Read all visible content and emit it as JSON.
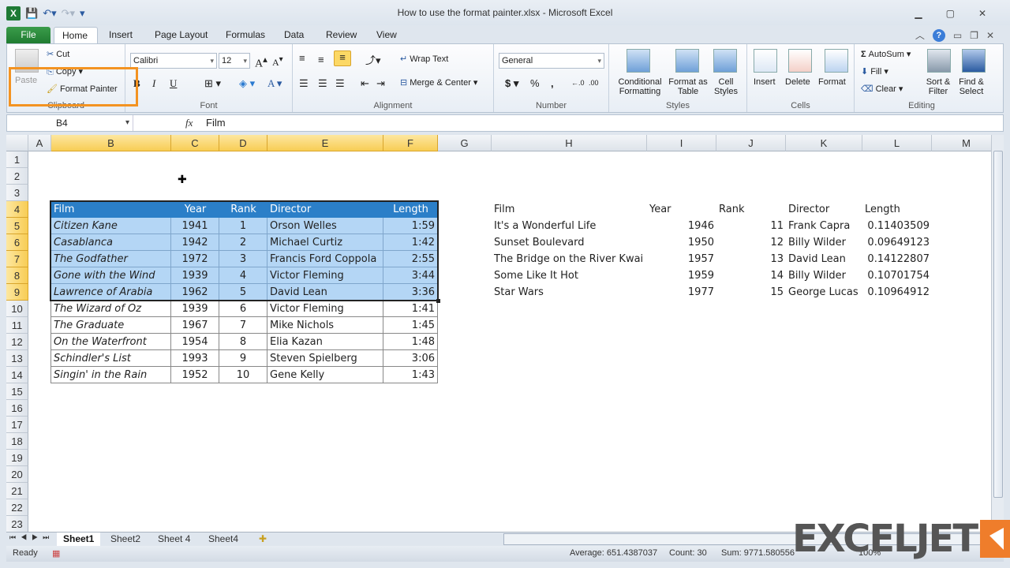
{
  "window": {
    "title": "How to use the format painter.xlsx - Microsoft Excel",
    "controls": [
      "minimize",
      "maximize",
      "close"
    ]
  },
  "qat": {
    "icons": [
      "excel-logo",
      "save-icon",
      "undo-icon",
      "redo-icon",
      "customize-icon"
    ]
  },
  "tabs": [
    "File",
    "Home",
    "Insert",
    "Page Layout",
    "Formulas",
    "Data",
    "Review",
    "View"
  ],
  "active_tab": "Home",
  "ribbon": {
    "clipboard": {
      "label": "Clipboard",
      "paste": "Paste",
      "cut": "Cut",
      "copy": "Copy",
      "format_painter": "Format Painter"
    },
    "font": {
      "label": "Font",
      "font_name": "Calibri",
      "font_size": "12",
      "bold": "B",
      "italic": "I",
      "underline": "U"
    },
    "alignment": {
      "label": "Alignment",
      "wrap_text": "Wrap Text",
      "merge_center": "Merge & Center"
    },
    "number": {
      "label": "Number",
      "format": "General",
      "currency": "$",
      "percent": "%",
      "comma": ","
    },
    "styles": {
      "label": "Styles",
      "conditional_formatting": "Conditional Formatting",
      "format_as_table": "Format as Table",
      "cell_styles": "Cell Styles"
    },
    "cells": {
      "label": "Cells",
      "insert": "Insert",
      "delete": "Delete",
      "format": "Format"
    },
    "editing": {
      "label": "Editing",
      "autosum": "AutoSum",
      "fill": "Fill",
      "clear": "Clear",
      "sort_filter": "Sort & Filter",
      "find_select": "Find & Select"
    }
  },
  "formula_bar": {
    "name_box": "B4",
    "fx": "fx",
    "value": "Film"
  },
  "columns": [
    "A",
    "B",
    "C",
    "D",
    "E",
    "F",
    "G",
    "H",
    "I",
    "J",
    "K",
    "L",
    "M"
  ],
  "selected_columns": [
    "B",
    "C",
    "D",
    "E",
    "F"
  ],
  "rows": [
    "1",
    "2",
    "3",
    "4",
    "5",
    "6",
    "7",
    "8",
    "9",
    "10",
    "11",
    "12",
    "13",
    "14",
    "15",
    "16",
    "17",
    "18",
    "19",
    "20",
    "21",
    "22",
    "23"
  ],
  "selected_rows": [
    "4",
    "5",
    "6",
    "7",
    "8",
    "9"
  ],
  "table": {
    "headers": [
      "Film",
      "Year",
      "Rank",
      "Director",
      "Length"
    ],
    "rows": [
      [
        "Citizen Kane",
        "1941",
        "1",
        "Orson Welles",
        "1:59"
      ],
      [
        "Casablanca",
        "1942",
        "2",
        "Michael Curtiz",
        "1:42"
      ],
      [
        "The Godfather",
        "1972",
        "3",
        "Francis Ford Coppola",
        "2:55"
      ],
      [
        "Gone with the Wind",
        "1939",
        "4",
        "Victor Fleming",
        "3:44"
      ],
      [
        "Lawrence of Arabia",
        "1962",
        "5",
        "David Lean",
        "3:36"
      ],
      [
        "The Wizard of Oz",
        "1939",
        "6",
        "Victor Fleming",
        "1:41"
      ],
      [
        "The Graduate",
        "1967",
        "7",
        "Mike Nichols",
        "1:45"
      ],
      [
        "On the Waterfront",
        "1954",
        "8",
        "Elia Kazan",
        "1:48"
      ],
      [
        "Schindler's List",
        "1993",
        "9",
        "Steven Spielberg",
        "3:06"
      ],
      [
        "Singin' in the Rain",
        "1952",
        "10",
        "Gene Kelly",
        "1:43"
      ]
    ]
  },
  "table2": {
    "headers": [
      "Film",
      "Year",
      "Rank",
      "Director",
      "Length"
    ],
    "rows": [
      [
        "It's a Wonderful Life",
        "1946",
        "11",
        "Frank Capra",
        "0.11403509"
      ],
      [
        "Sunset Boulevard",
        "1950",
        "12",
        "Billy Wilder",
        "0.09649123"
      ],
      [
        "The Bridge on the River Kwai",
        "1957",
        "13",
        "David Lean",
        "0.14122807"
      ],
      [
        "Some Like It Hot",
        "1959",
        "14",
        "Billy Wilder",
        "0.10701754"
      ],
      [
        "Star Wars",
        "1977",
        "15",
        "George Lucas",
        "0.10964912"
      ]
    ]
  },
  "sheets": [
    "Sheet1",
    "Sheet2",
    "Sheet 4",
    "Sheet4"
  ],
  "active_sheet": "Sheet1",
  "status": {
    "mode": "Ready",
    "average": "Average: 651.4387037",
    "count": "Count: 30",
    "sum": "Sum: 9771.580556",
    "zoom": "100%"
  },
  "watermark": "EXCELJET",
  "colors": {
    "highlight": "#f39322",
    "table_header": "#2b7fc8",
    "selection_fill": "#b4d6f5",
    "watermark_orange": "#ef7d2b"
  }
}
